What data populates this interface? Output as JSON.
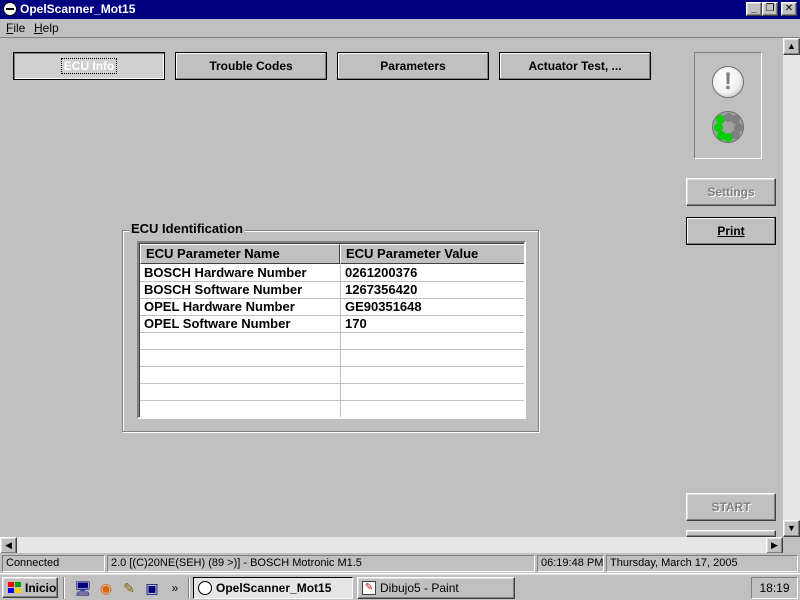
{
  "window": {
    "title": "OpelScanner_Mot15",
    "controls": [
      "minimize",
      "maximize",
      "close"
    ]
  },
  "menu": [
    {
      "label": "File"
    },
    {
      "label": "Help"
    }
  ],
  "tabs": [
    {
      "label": "ECU Info",
      "active": true
    },
    {
      "label": "Trouble Codes",
      "active": false
    },
    {
      "label": "Parameters",
      "active": false
    },
    {
      "label": "Actuator Test, ...",
      "active": false
    }
  ],
  "status_icons": {
    "warning": "!",
    "warning_icon": "exclamation-icon",
    "activity_icon": "led-ring-icon",
    "leds_on": [
      0,
      1,
      2,
      3
    ]
  },
  "side_buttons": {
    "settings": "Settings",
    "print": "Print",
    "start": "START"
  },
  "ecu_identification": {
    "title": "ECU Identification",
    "columns": [
      "ECU Parameter Name",
      "ECU Parameter Value"
    ],
    "rows": [
      {
        "name": "BOSCH Hardware Number",
        "value": "0261200376"
      },
      {
        "name": "BOSCH Software Number",
        "value": "1267356420"
      },
      {
        "name": "OPEL Hardware Number",
        "value": "GE90351648"
      },
      {
        "name": "OPEL Software Number",
        "value": "170"
      },
      {
        "name": "",
        "value": ""
      },
      {
        "name": "",
        "value": ""
      },
      {
        "name": "",
        "value": ""
      },
      {
        "name": "",
        "value": ""
      },
      {
        "name": "",
        "value": ""
      }
    ]
  },
  "statusbar": {
    "connection": "Connected",
    "ecu": "2.0 [(C)20NE(SEH)  (89 >)] - BOSCH Motronic M1.5",
    "time": "06:19:48 PM",
    "date": "Thursday, March 17, 2005"
  },
  "taskbar": {
    "start": "Inicio",
    "quick_launch": [
      "desktop-icon",
      "firefox-icon",
      "pencil-icon",
      "network-icon"
    ],
    "overflow": "»",
    "tasks": [
      {
        "label": "OpelScanner_Mot15",
        "active": true
      },
      {
        "label": "Dibujo5 - Paint",
        "active": false
      }
    ],
    "clock": "18:19"
  },
  "colors": {
    "titlebar": "#000080",
    "face": "#c0c0c0",
    "led_on": "#00d000"
  }
}
